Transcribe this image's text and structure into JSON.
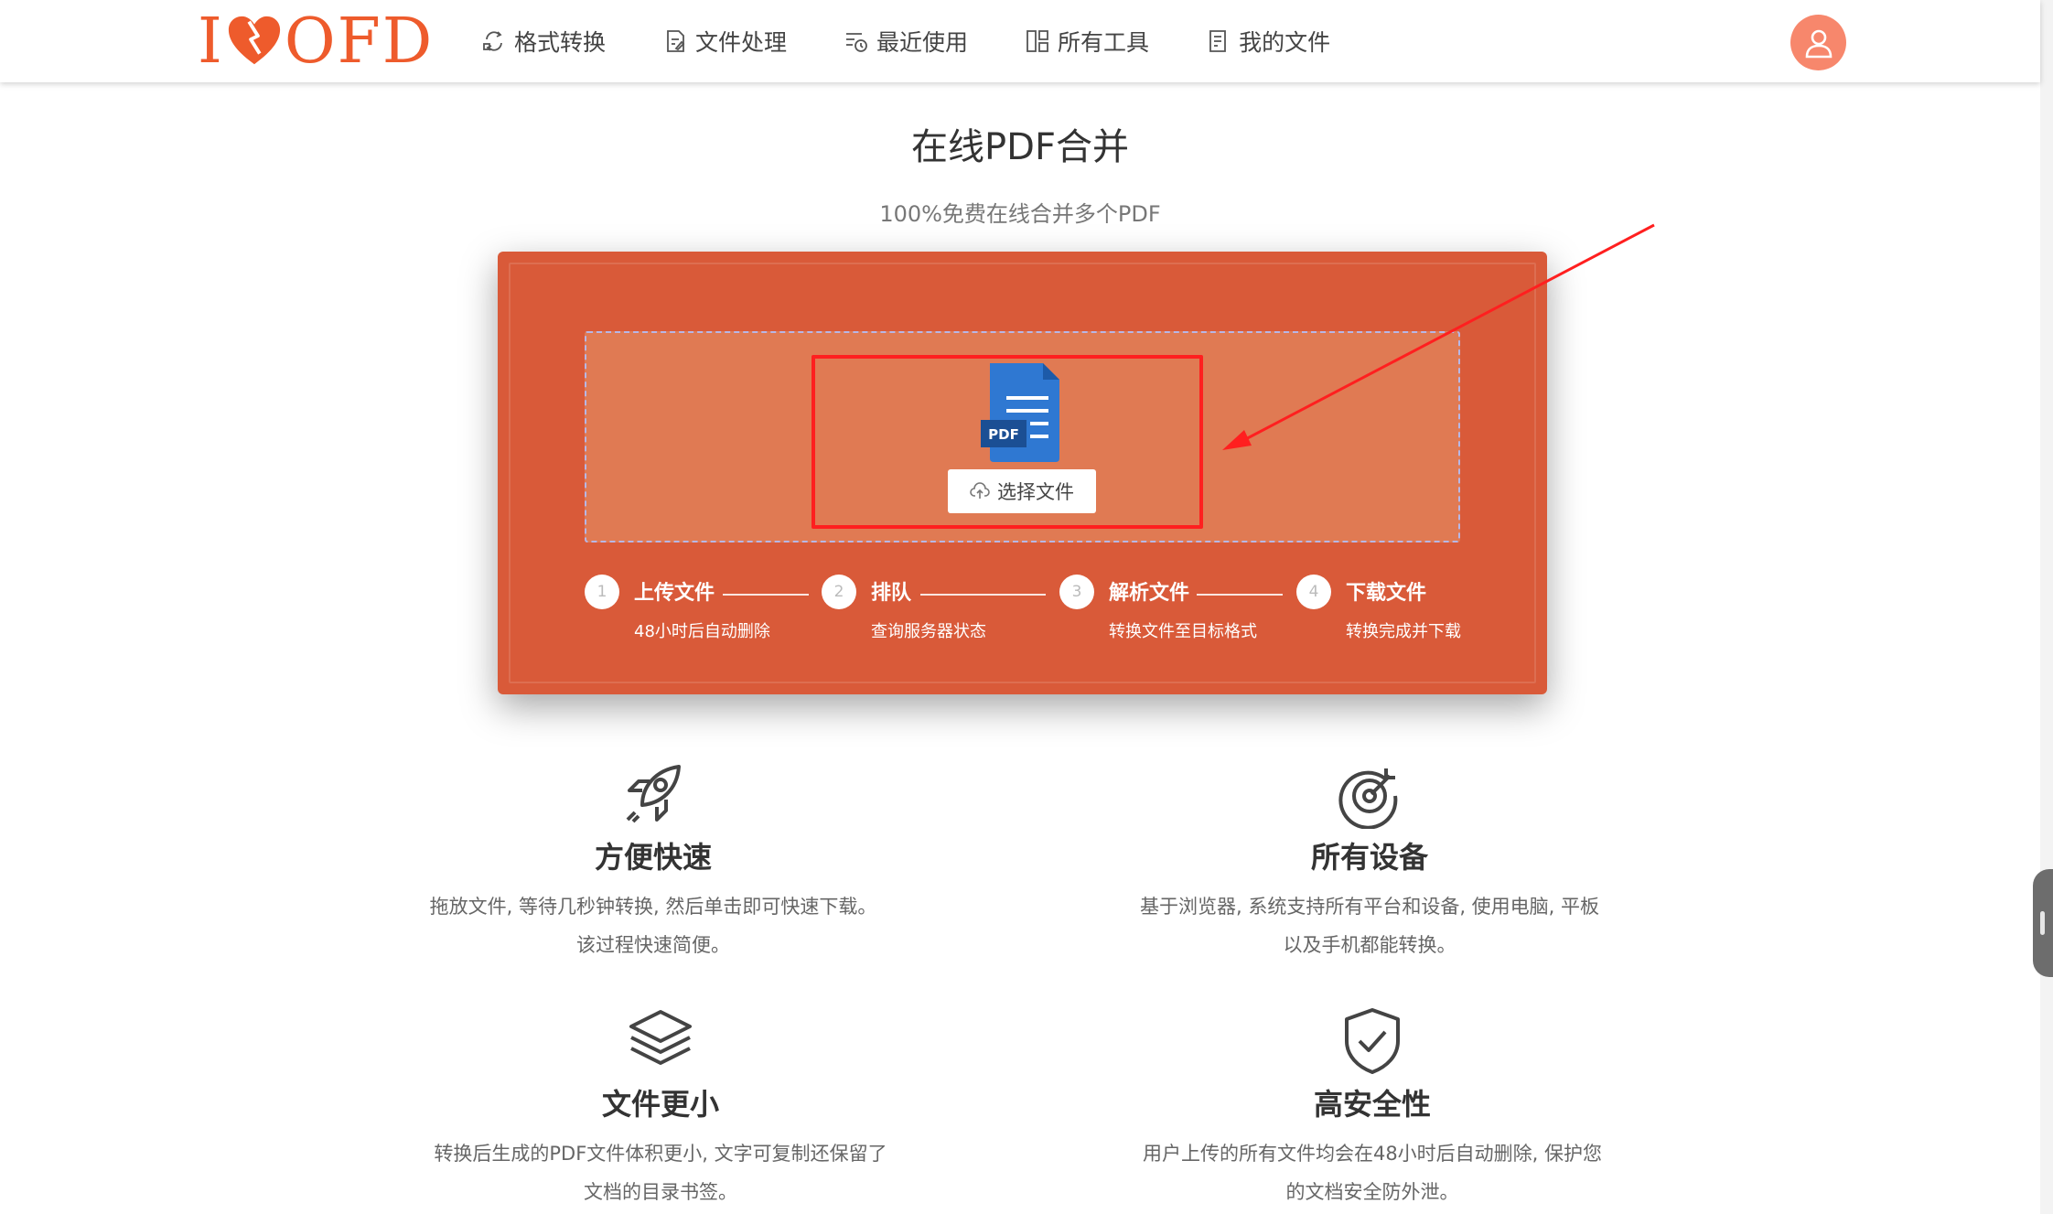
{
  "logo": {
    "left": "I",
    "right": "OFD"
  },
  "nav": [
    {
      "label": "格式转换",
      "icon": "convert-icon"
    },
    {
      "label": "文件处理",
      "icon": "file-edit-icon"
    },
    {
      "label": "最近使用",
      "icon": "recent-icon"
    },
    {
      "label": "所有工具",
      "icon": "grid-icon"
    },
    {
      "label": "我的文件",
      "icon": "my-files-icon"
    }
  ],
  "page": {
    "title": "在线PDF合并",
    "subtitle": "100%免费在线合并多个PDF"
  },
  "upload": {
    "file_badge": "PDF",
    "button_label": "选择文件"
  },
  "steps": [
    {
      "num": "1",
      "title": "上传文件",
      "desc": "48小时后自动删除"
    },
    {
      "num": "2",
      "title": "排队",
      "desc": "查询服务器状态"
    },
    {
      "num": "3",
      "title": "解析文件",
      "desc": "转换文件至目标格式"
    },
    {
      "num": "4",
      "title": "下载文件",
      "desc": "转换完成并下载"
    }
  ],
  "features": [
    {
      "title": "方便快速",
      "line1": "拖放文件, 等待几秒钟转换, 然后单击即可快速下载。",
      "line2": "该过程快速简便。",
      "icon": "rocket-icon"
    },
    {
      "title": "所有设备",
      "line1": "基于浏览器, 系统支持所有平台和设备, 使用电脑, 平板",
      "line2": "以及手机都能转换。",
      "icon": "target-icon"
    },
    {
      "title": "文件更小",
      "line1": "转换后生成的PDF文件体积更小, 文字可复制还保留了",
      "line2": "文档的目录书签。",
      "icon": "layers-icon"
    },
    {
      "title": "高安全性",
      "line1": "用户上传的所有文件均会在48小时后自动删除, 保护您",
      "line2": "的文档安全防外泄。",
      "icon": "shield-check-icon"
    }
  ],
  "colors": {
    "brand": "#ee5b2c",
    "panel": "#d95a39",
    "dropzone": "#e07a53",
    "highlight": "#ff1f1f"
  }
}
